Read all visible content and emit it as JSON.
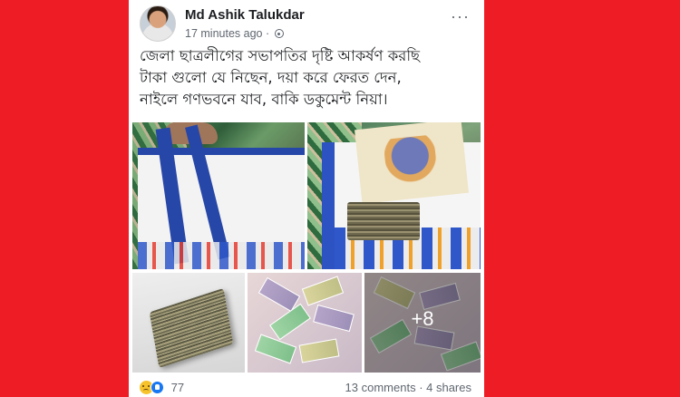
{
  "post": {
    "author": "Md Ashik Talukdar",
    "time": "17 minutes ago",
    "separator": "·",
    "privacy_icon": "globe-icon",
    "more_icon": "more-options-icon",
    "text_lines": [
      "জেলা ছাত্রলীগের সভাপতির দৃষ্টি আকর্ষণ করছি",
      "টাকা গুলো যে নিছেন, দয়া করে ফেরত দেন,",
      "নাইলে গণভবনে যাব, বাকি ডকুমেন্ট নিয়া।"
    ],
    "photos": {
      "extra_count": "+8"
    },
    "footer": {
      "reaction_icons": [
        "sad-reaction-icon",
        "like-reaction-icon"
      ],
      "reaction_count": "77",
      "stats": "13 comments · 4 shares"
    }
  },
  "colors": {
    "background": "#ee1c25",
    "card": "#ffffff",
    "text": "#1c1e21",
    "meta": "#606770",
    "like_blue": "#1877f2"
  }
}
